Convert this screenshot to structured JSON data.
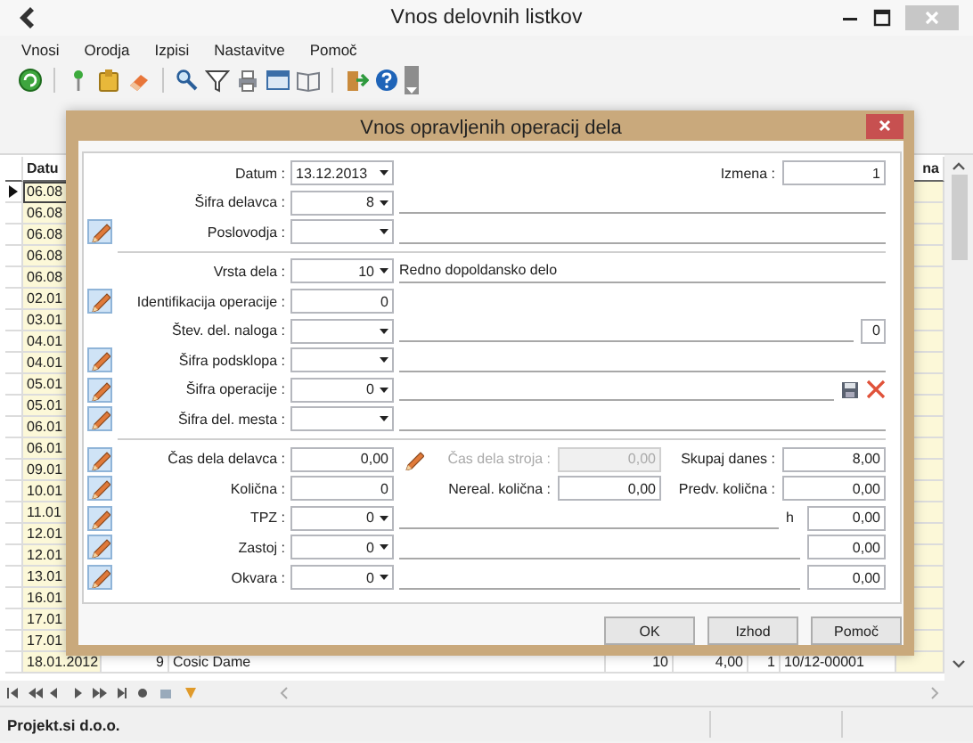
{
  "window": {
    "title": "Vnos delovnih listkov"
  },
  "menu": [
    "Vnosi",
    "Orodja",
    "Izpisi",
    "Nastavitve",
    "Pomoč"
  ],
  "grid": {
    "columns": [
      "Datu",
      "na"
    ],
    "rows": [
      {
        "selected": true,
        "cells": [
          "06.08"
        ]
      },
      {
        "selected": false,
        "cells": [
          "06.08"
        ]
      },
      {
        "selected": false,
        "cells": [
          "06.08"
        ]
      },
      {
        "selected": false,
        "cells": [
          "06.08"
        ]
      },
      {
        "selected": false,
        "cells": [
          "06.08"
        ]
      },
      {
        "selected": false,
        "cells": [
          "02.01"
        ]
      },
      {
        "selected": false,
        "cells": [
          "03.01"
        ]
      },
      {
        "selected": false,
        "cells": [
          "04.01"
        ]
      },
      {
        "selected": false,
        "cells": [
          "04.01"
        ]
      },
      {
        "selected": false,
        "cells": [
          "05.01"
        ]
      },
      {
        "selected": false,
        "cells": [
          "05.01"
        ]
      },
      {
        "selected": false,
        "cells": [
          "06.01"
        ]
      },
      {
        "selected": false,
        "cells": [
          "06.01"
        ]
      },
      {
        "selected": false,
        "cells": [
          "09.01"
        ]
      },
      {
        "selected": false,
        "cells": [
          "10.01"
        ]
      },
      {
        "selected": false,
        "cells": [
          "11.01"
        ]
      },
      {
        "selected": false,
        "cells": [
          "12.01"
        ]
      },
      {
        "selected": false,
        "cells": [
          "12.01"
        ]
      },
      {
        "selected": false,
        "cells": [
          "13.01"
        ]
      },
      {
        "selected": false,
        "cells": [
          "16.01"
        ]
      },
      {
        "selected": false,
        "cells": [
          "17.01"
        ]
      },
      {
        "selected": false,
        "cells": [
          "17.01"
        ]
      },
      {
        "selected": false,
        "cells": [
          "18.01.2012",
          "9",
          "Cosic Dame",
          "10",
          "4,00",
          "1",
          "10/12-00001"
        ]
      }
    ]
  },
  "status_bar": "Projekt.si d.o.o.",
  "dialog": {
    "title": "Vnos opravljenih operacij dela",
    "rows": [
      {
        "kind": "fields",
        "edit": false,
        "label": "Datum :",
        "field": {
          "kind": "date",
          "value": "13.12.2013"
        },
        "rest": [
          {
            "kind": "gap"
          },
          {
            "kind": "pair",
            "label": "Izmena :",
            "value": "1",
            "disabled": false
          }
        ]
      },
      {
        "kind": "fields",
        "edit": false,
        "label": "Šifra delavca :",
        "field": {
          "kind": "combo",
          "value": "8"
        },
        "rest": [
          {
            "kind": "line"
          }
        ]
      },
      {
        "kind": "fields",
        "edit": true,
        "label": "Poslovodja :",
        "field": {
          "kind": "combo"
        },
        "rest": [
          {
            "kind": "line"
          }
        ]
      },
      {
        "kind": "separator"
      },
      {
        "kind": "fields",
        "edit": false,
        "label": "Vrsta dela :",
        "field": {
          "kind": "combo",
          "value": "10"
        },
        "rest": [
          {
            "kind": "desc",
            "text": "Redno dopoldansko delo"
          }
        ]
      },
      {
        "kind": "fields",
        "edit": true,
        "label": "Identifikacija operacije :",
        "field": {
          "kind": "text",
          "value": "0"
        },
        "rest": []
      },
      {
        "kind": "fields",
        "edit": false,
        "label": "Štev. del. naloga :",
        "field": {
          "kind": "combo"
        },
        "rest": [
          {
            "kind": "line"
          },
          {
            "kind": "box",
            "value": "0"
          }
        ]
      },
      {
        "kind": "fields",
        "edit": true,
        "label": "Šifra podsklopa :",
        "field": {
          "kind": "combo"
        },
        "rest": [
          {
            "kind": "line"
          }
        ]
      },
      {
        "kind": "fields",
        "edit": true,
        "label": "Šifra operacije :",
        "field": {
          "kind": "combo",
          "value": "0"
        },
        "rest": [
          {
            "kind": "line"
          },
          {
            "kind": "save"
          },
          {
            "kind": "delete"
          }
        ]
      },
      {
        "kind": "fields",
        "edit": true,
        "label": "Šifra del. mesta :",
        "field": {
          "kind": "combo"
        },
        "rest": [
          {
            "kind": "line"
          }
        ]
      },
      {
        "kind": "separator"
      },
      {
        "kind": "fields",
        "edit": true,
        "label": "Čas dela delavca :",
        "field": {
          "kind": "text",
          "value": "0,00"
        },
        "rest": [
          {
            "kind": "pencil"
          },
          {
            "kind": "pair",
            "label": "Čas dela stroja :",
            "value": "0,00",
            "disabled": true
          },
          {
            "kind": "pair",
            "label": "Skupaj danes :",
            "value": "8,00",
            "disabled": false
          }
        ]
      },
      {
        "kind": "fields",
        "edit": true,
        "label": "Količna :",
        "field": {
          "kind": "text",
          "value": "0"
        },
        "rest": [
          {
            "kind": "pair",
            "label": "Nereal. količna :",
            "value": "0,00",
            "disabled": false
          },
          {
            "kind": "pair",
            "label": "Predv. količna :",
            "value": "0,00",
            "disabled": false
          }
        ]
      },
      {
        "kind": "fields",
        "edit": true,
        "label": "TPZ :",
        "field": {
          "kind": "combo",
          "value": "0"
        },
        "rest": [
          {
            "kind": "line"
          },
          {
            "kind": "unit",
            "text": "h"
          },
          {
            "kind": "box",
            "value": "0,00"
          }
        ]
      },
      {
        "kind": "fields",
        "edit": true,
        "label": "Zastoj :",
        "field": {
          "kind": "combo",
          "value": "0"
        },
        "rest": [
          {
            "kind": "line"
          },
          {
            "kind": "box",
            "value": "0,00"
          }
        ]
      },
      {
        "kind": "fields",
        "edit": true,
        "label": "Okvara :",
        "field": {
          "kind": "combo",
          "value": "0"
        },
        "rest": [
          {
            "kind": "line"
          },
          {
            "kind": "box",
            "value": "0,00"
          }
        ]
      }
    ],
    "buttons": [
      "OK",
      "Izhod",
      "Pomoč"
    ]
  }
}
